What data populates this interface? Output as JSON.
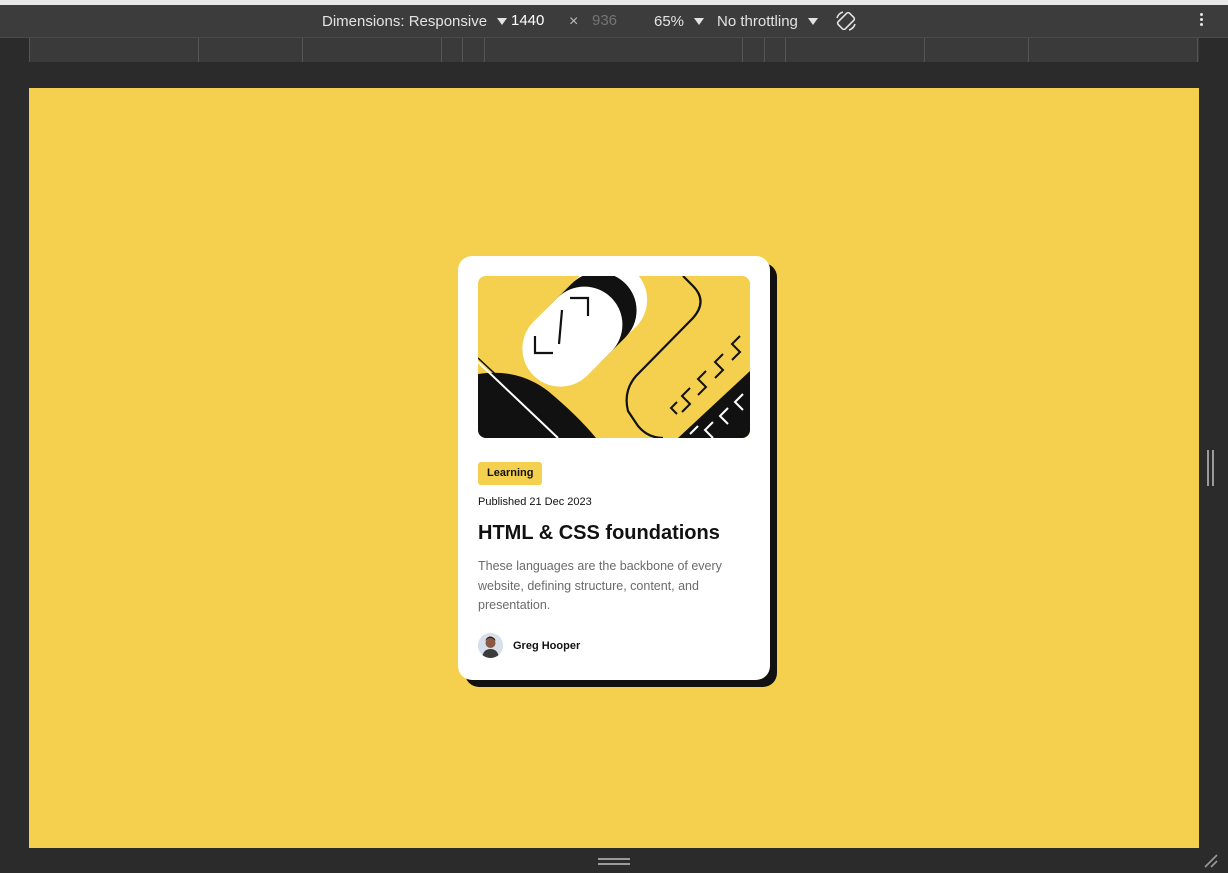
{
  "devtools": {
    "dimensions_label": "Dimensions: Responsive",
    "width_value": "1440",
    "height_placeholder": "936",
    "times_symbol": "×",
    "zoom_label": "65%",
    "throttling_label": "No throttling",
    "rotate_icon": "rotate-icon",
    "more_icon": "kebab-menu-icon"
  },
  "page": {
    "background_color": "#f4d04e",
    "card": {
      "image_icon": "illustration-article",
      "tag": "Learning",
      "published": "Published 21 Dec 2023",
      "title": "HTML & CSS foundations",
      "description": "These languages are the backbone of every website, defining structure, content, and presentation.",
      "author_name": "Greg Hooper"
    }
  },
  "colors": {
    "accent_yellow": "#f4d04e",
    "card_shadow": "#111111",
    "text_dark": "#111111",
    "text_muted": "#6b6b6b",
    "devtools_bg": "#3c3c3c"
  }
}
